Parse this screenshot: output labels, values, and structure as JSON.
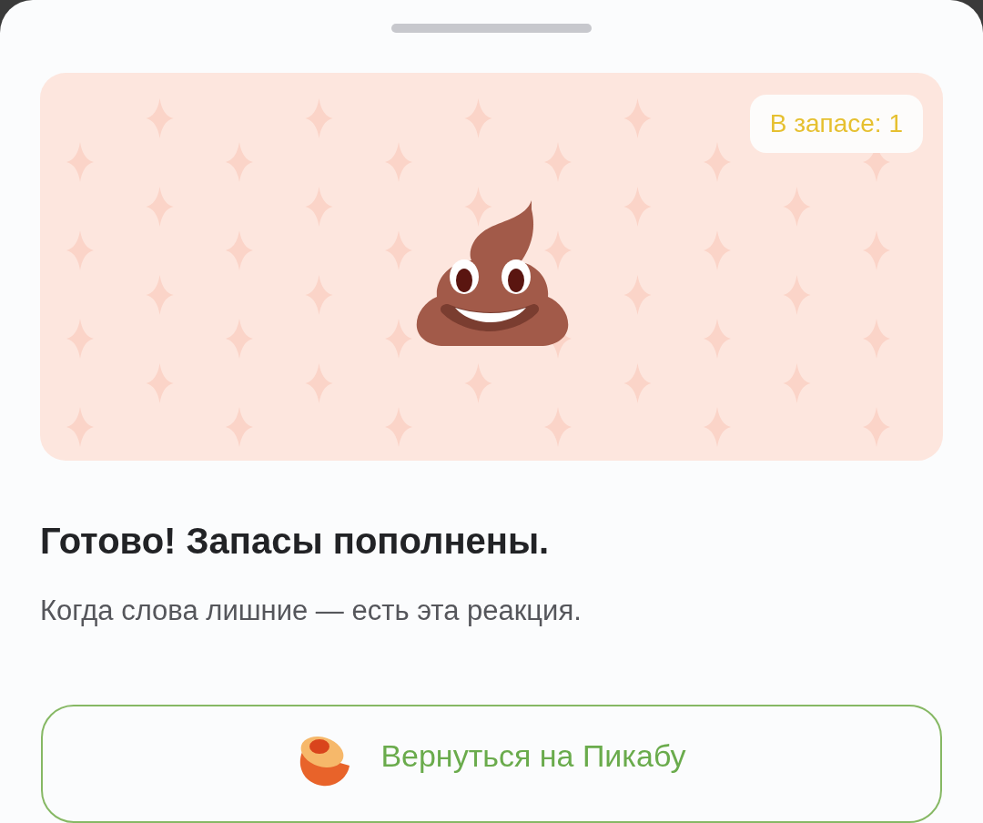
{
  "banner": {
    "badge": "В запасе: 1"
  },
  "title": "Готово! Запасы пополнены.",
  "subtitle": "Когда слова лишние — есть эта реакция.",
  "button": {
    "label": "Вернуться на Пикабу"
  }
}
